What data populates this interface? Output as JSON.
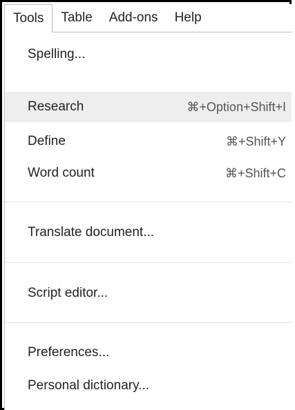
{
  "menubar": {
    "items": [
      {
        "label": "Tools",
        "active": true
      },
      {
        "label": "Table",
        "active": false
      },
      {
        "label": "Add-ons",
        "active": false
      },
      {
        "label": "Help",
        "active": false
      }
    ]
  },
  "tools_menu": {
    "items": [
      {
        "label": "Spelling...",
        "shortcut": ""
      },
      {
        "label": "Research",
        "shortcut": "⌘+Option+Shift+I",
        "highlighted": true
      },
      {
        "label": "Define",
        "shortcut": "⌘+Shift+Y"
      },
      {
        "label": "Word count",
        "shortcut": "⌘+Shift+C"
      },
      {
        "label": "Translate document...",
        "shortcut": ""
      },
      {
        "label": "Script editor...",
        "shortcut": ""
      },
      {
        "label": "Preferences...",
        "shortcut": ""
      },
      {
        "label": "Personal dictionary...",
        "shortcut": ""
      }
    ]
  },
  "colors": {
    "highlight_background": "#eeeeee",
    "text": "#222222",
    "shortcut_text": "#555555",
    "separator": "#e0e0e0"
  }
}
